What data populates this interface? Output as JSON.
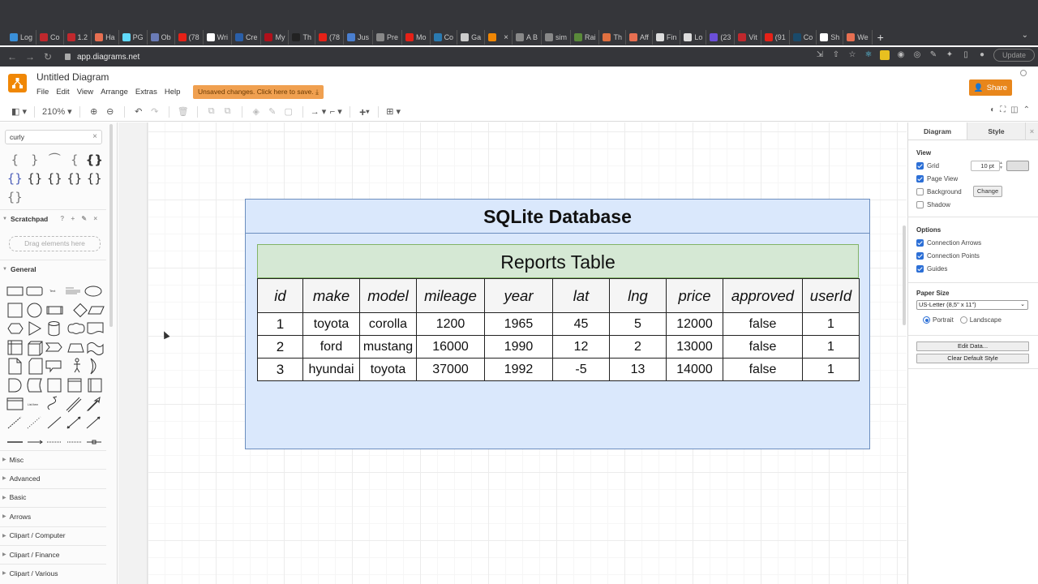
{
  "browser": {
    "tabs": [
      {
        "label": "Log",
        "color": "#3a8fd8"
      },
      {
        "label": "Co",
        "color": "#c0282d"
      },
      {
        "label": "1.2",
        "color": "#c0282d"
      },
      {
        "label": "Ha",
        "color": "#e76f51"
      },
      {
        "label": "PG",
        "color": "#61dafb"
      },
      {
        "label": "Ob",
        "color": "#6a7bb6"
      },
      {
        "label": "(78",
        "color": "#e62117"
      },
      {
        "label": "Wri",
        "color": "#ffffff"
      },
      {
        "label": "Cre",
        "color": "#2a5fa8"
      },
      {
        "label": "My",
        "color": "#b0101a"
      },
      {
        "label": "Th",
        "color": "#222222"
      },
      {
        "label": "(78",
        "color": "#e62117"
      },
      {
        "label": "Jus",
        "color": "#4a7fd0"
      },
      {
        "label": "Pre",
        "color": "#888888"
      },
      {
        "label": "Mo",
        "color": "#e62117"
      },
      {
        "label": "Co",
        "color": "#2a7ab0"
      },
      {
        "label": "Ga",
        "color": "#cccccc"
      },
      {
        "label": "",
        "color": "#f08705",
        "active": true
      },
      {
        "label": "A B",
        "color": "#888888"
      },
      {
        "label": "sim",
        "color": "#888888"
      },
      {
        "label": "Rai",
        "color": "#5a8a3a"
      },
      {
        "label": "Th",
        "color": "#e07040"
      },
      {
        "label": "Aff",
        "color": "#e76f51"
      },
      {
        "label": "Fin",
        "color": "#dddddd"
      },
      {
        "label": "Lo",
        "color": "#dddddd"
      },
      {
        "label": "(23",
        "color": "#6b4fd8"
      },
      {
        "label": "Vit",
        "color": "#c0282d"
      },
      {
        "label": "(91",
        "color": "#e62117"
      },
      {
        "label": "Co",
        "color": "#1a4a6a"
      },
      {
        "label": "Sh",
        "color": "#ffffff"
      },
      {
        "label": "We",
        "color": "#e76f51"
      }
    ],
    "close_glyph": "×",
    "new_tab_glyph": "+",
    "tab_menu_glyph": "⌄",
    "url": "app.diagrams.net",
    "update_label": "Update"
  },
  "app": {
    "title": "Untitled Diagram",
    "menu": [
      "File",
      "Edit",
      "View",
      "Arrange",
      "Extras",
      "Help"
    ],
    "unsaved_label": "Unsaved changes. Click here to save.",
    "share_label": "Share",
    "zoom_level": "210%"
  },
  "sidebar": {
    "search_value": "curly",
    "curly_shapes": [
      [
        "{",
        "}",
        "⏜",
        "{",
        "{}"
      ],
      [
        "{}",
        "{}",
        "{}",
        "{}",
        "{}"
      ],
      [
        "{}"
      ]
    ],
    "scratchpad_label": "Scratchpad",
    "scratchpad_tools": "? + ✎ ×",
    "drop_hint": "Drag elements here",
    "general_label": "General",
    "sections": [
      "Misc",
      "Advanced",
      "Basic",
      "Arrows",
      "Clipart / Computer",
      "Clipart / Finance",
      "Clipart / Various"
    ]
  },
  "diagram": {
    "container_title": "SQLite Database",
    "table_title": "Reports Table",
    "columns": [
      "id",
      "make",
      "model",
      "mileage",
      "year",
      "lat",
      "lng",
      "price",
      "approved",
      "userId"
    ],
    "rows": [
      [
        "1",
        "toyota",
        "corolla",
        "1200",
        "1965",
        "45",
        "5",
        "12000",
        "false",
        "1"
      ],
      [
        "2",
        "ford",
        "mustang",
        "16000",
        "1990",
        "12",
        "2",
        "13000",
        "false",
        "1"
      ],
      [
        "3",
        "hyundai",
        "toyota",
        "37000",
        "1992",
        "-5",
        "13",
        "14000",
        "false",
        "1"
      ]
    ],
    "colors": {
      "container_fill": "#dae8fc",
      "container_stroke": "#6c8ebf",
      "table_fill": "#d5e8d4",
      "table_stroke": "#82b366"
    }
  },
  "format_panel": {
    "tabs": [
      "Diagram",
      "Style"
    ],
    "view_title": "View",
    "grid_label": "Grid",
    "grid_checked": true,
    "grid_size": "10 pt",
    "page_view_label": "Page View",
    "page_view_checked": true,
    "background_label": "Background",
    "background_checked": false,
    "change_label": "Change",
    "shadow_label": "Shadow",
    "shadow_checked": false,
    "options_title": "Options",
    "connection_arrows_label": "Connection Arrows",
    "connection_points_label": "Connection Points",
    "guides_label": "Guides",
    "paper_size_title": "Paper Size",
    "paper_size_value": "US-Letter (8,5\" x 11\")",
    "portrait_label": "Portrait",
    "landscape_label": "Landscape",
    "orientation": "Portrait",
    "edit_data_label": "Edit Data...",
    "clear_style_label": "Clear Default Style"
  }
}
